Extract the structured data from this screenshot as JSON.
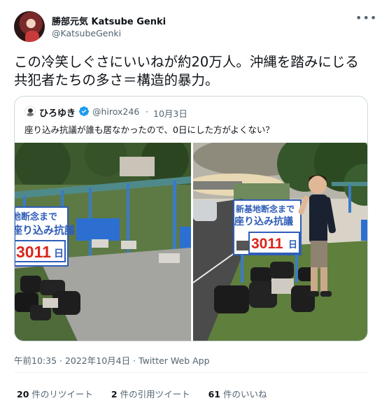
{
  "author": {
    "display_name": "勝部元気 Katsube Genki",
    "handle": "@KatsubeGenki"
  },
  "more_icon": "more-horizontal-icon",
  "tweet_text": "この冷笑しぐさにいいねが約20万人。沖縄を踏みにじる共犯者たちの多さ＝構造的暴力。",
  "quoted": {
    "display_name": "ひろゆき",
    "verified": true,
    "handle": "@hirox246",
    "separator": "·",
    "date": "10月3日",
    "text": "座り込み抗議が誰も居なかったので、0日にした方がよくない？",
    "photos": [
      {
        "sign_line1": "地断念まで",
        "sign_line2": "座り込み抗議",
        "sign_number": "3011",
        "sign_unit": "日"
      },
      {
        "sign_line1": "新基地断念まで",
        "sign_line2": "座り込み抗議",
        "sign_number": "3011",
        "sign_unit": "日"
      }
    ]
  },
  "meta_line": "午前10:35 · 2022年10月4日 · Twitter Web App",
  "stats": [
    {
      "count": "20",
      "label": "件のリツイート"
    },
    {
      "count": "2",
      "label": "件の引用ツイート"
    },
    {
      "count": "61",
      "label": "件のいいね"
    }
  ],
  "colors": {
    "accent": "#1d9bf0",
    "text_primary": "#0f1419",
    "text_secondary": "#536471",
    "border": "#cfd9de",
    "sign_blue": "#2f5db8",
    "sign_red": "#d8261c"
  }
}
